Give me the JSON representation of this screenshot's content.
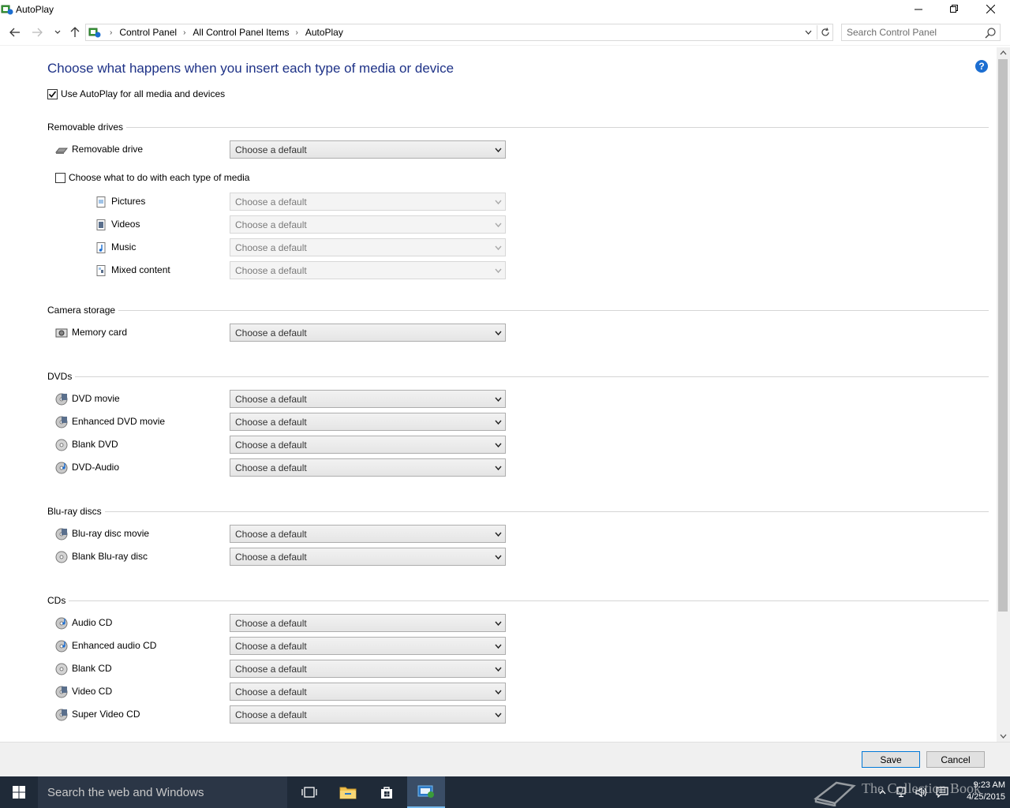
{
  "window": {
    "title": "AutoPlay",
    "minimize_icon": "minimize-icon",
    "maximize_icon": "restore-icon",
    "close_icon": "close-icon"
  },
  "nav": {
    "breadcrumbs": [
      "Control Panel",
      "All Control Panel Items",
      "AutoPlay"
    ],
    "search_placeholder": "Search Control Panel"
  },
  "page": {
    "heading": "Choose what happens when you insert each type of media or device",
    "use_autoplay_label": "Use AutoPlay for all media and devices",
    "use_autoplay_checked": true,
    "help_glyph": "?"
  },
  "default_choice": "Choose a default",
  "removable": {
    "title": "Removable drives",
    "drive_label": "Removable drive",
    "media_checkbox_label": "Choose what to do with each type of media",
    "media_checked": false,
    "media_items": [
      "Pictures",
      "Videos",
      "Music",
      "Mixed content"
    ]
  },
  "camera": {
    "title": "Camera storage",
    "items": [
      "Memory card"
    ]
  },
  "dvds": {
    "title": "DVDs",
    "items": [
      "DVD movie",
      "Enhanced DVD movie",
      "Blank DVD",
      "DVD-Audio"
    ]
  },
  "bluray": {
    "title": "Blu-ray discs",
    "items": [
      "Blu-ray disc movie",
      "Blank Blu-ray disc"
    ]
  },
  "cds": {
    "title": "CDs",
    "items": [
      "Audio CD",
      "Enhanced audio CD",
      "Blank CD",
      "Video CD",
      "Super Video CD"
    ]
  },
  "buttons": {
    "save": "Save",
    "cancel": "Cancel"
  },
  "taskbar": {
    "search_text": "Search the web and Windows",
    "time": "9:23 AM",
    "date": "4/25/2015"
  },
  "watermark": "The Collection Book",
  "colors": {
    "heading": "#1e3287",
    "taskbar": "#1f2a38",
    "accent": "#0078d7"
  }
}
